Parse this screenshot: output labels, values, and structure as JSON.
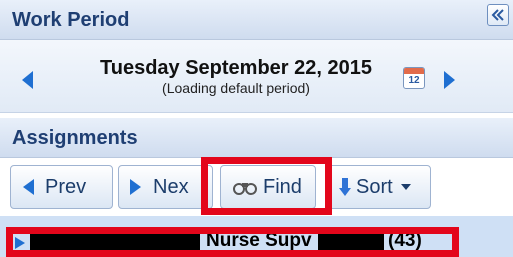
{
  "work_period": {
    "title": "Work Period",
    "date": "Tuesday September 22, 2015",
    "status": "(Loading default period)",
    "calendar_day": "12"
  },
  "assignments": {
    "title": "Assignments",
    "buttons": {
      "prev": "Prev",
      "next": "Nex",
      "find": "Find",
      "sort": "Sort"
    },
    "row": {
      "label": "Nurse Supv",
      "count": "(43)"
    }
  },
  "colors": {
    "header_text": "#1f3f73",
    "highlight": "#e3061b",
    "nav_arrow": "#1f6fd1",
    "row_bg": "#cfe0f5"
  }
}
